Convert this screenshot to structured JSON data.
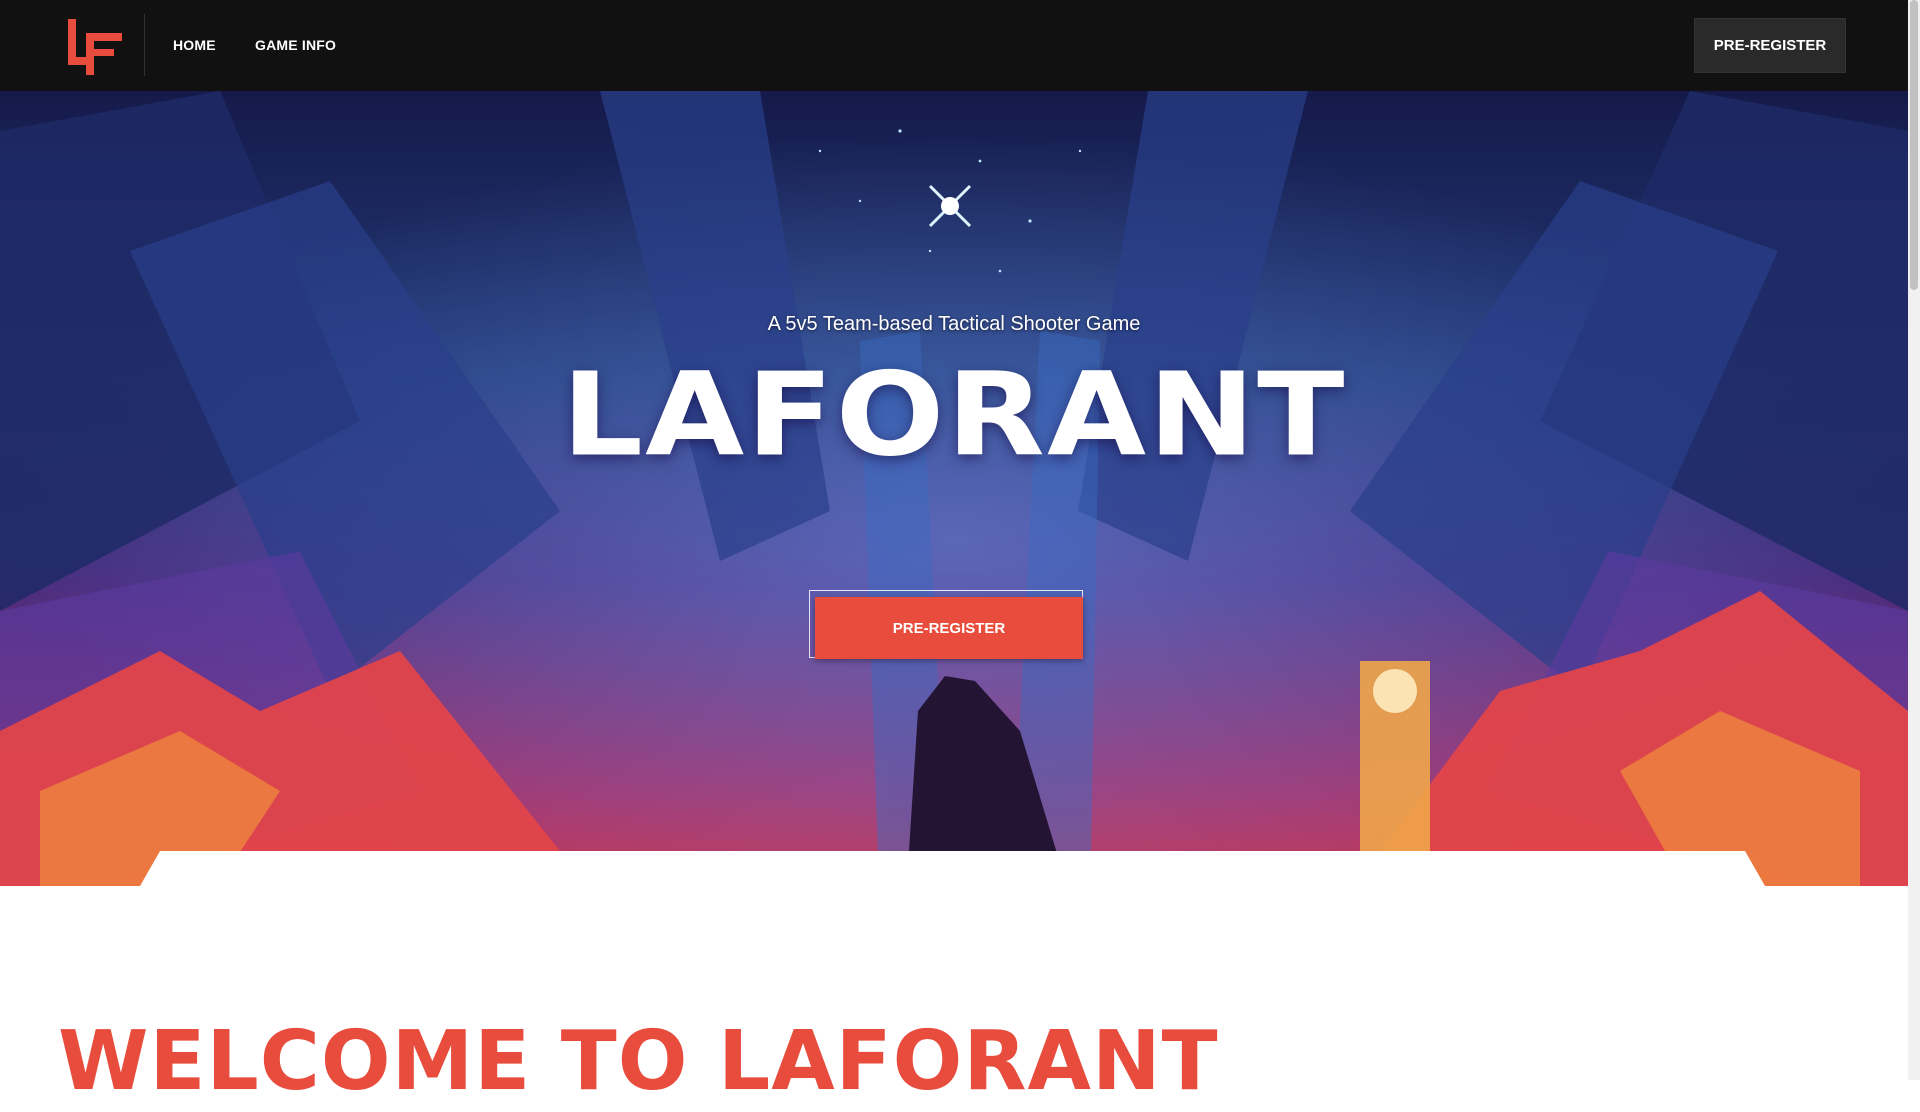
{
  "nav": {
    "logo_text": "LF",
    "links": [
      {
        "label": "HOME"
      },
      {
        "label": "GAME INFO"
      }
    ],
    "cta_label": "PRE-REGISTER"
  },
  "hero": {
    "subtitle": "A 5v5 Team-based Tactical Shooter Game",
    "title": "LAFORANT",
    "cta_label": "PRE-REGISTER"
  },
  "welcome": {
    "heading": "WELCOME TO LAFORANT"
  },
  "colors": {
    "accent": "#e84c3d",
    "nav_bg": "#111111",
    "hero_top": "#1b1f5e",
    "hero_bottom": "#c8344f"
  }
}
